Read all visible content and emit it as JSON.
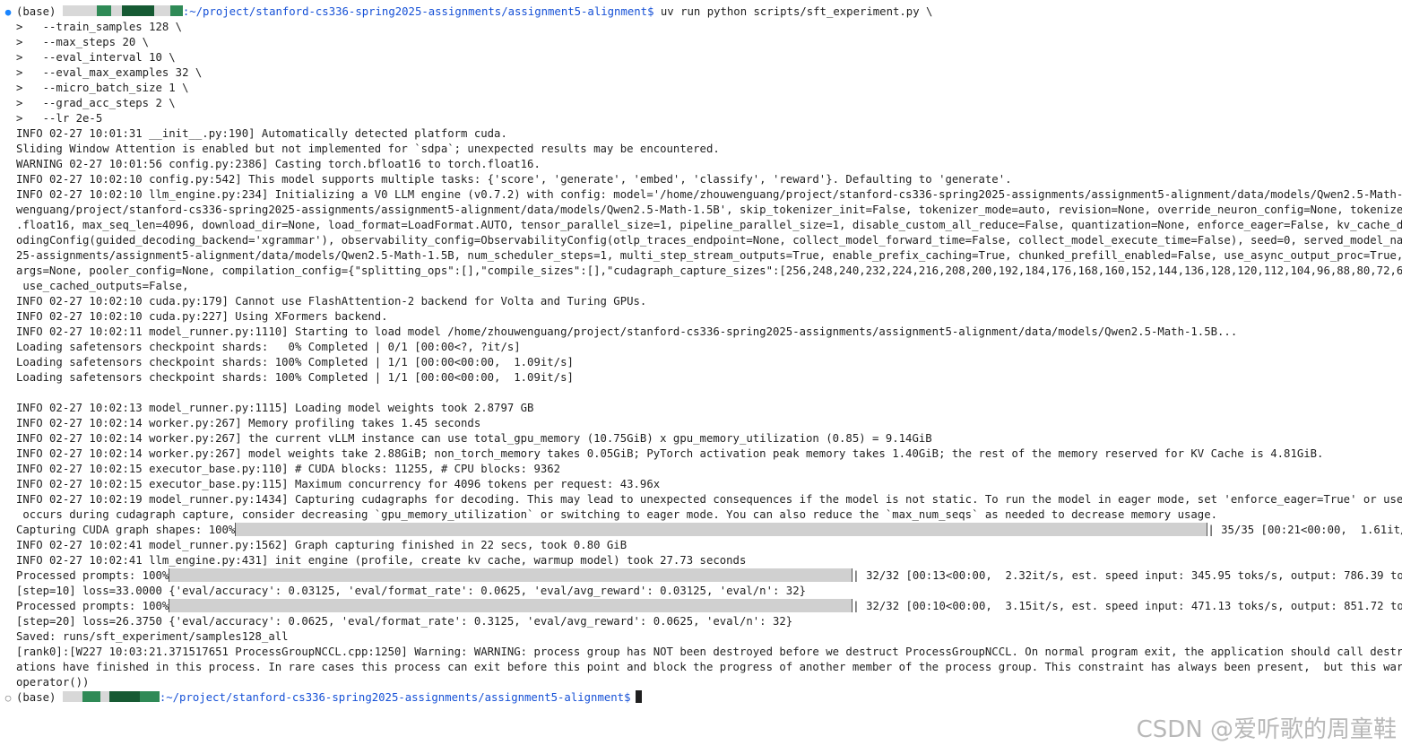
{
  "terminal": {
    "cmd": {
      "env": "(base)",
      "path": ":~/project/stanford-cs336-spring2025-assignments/assignment5-alignment$",
      "command": " uv run python scripts/sft_experiment.py \\"
    },
    "args": [
      ">   --train_samples 128 \\",
      ">   --max_steps 20 \\",
      ">   --eval_interval 10 \\",
      ">   --eval_max_examples 32 \\",
      ">   --micro_batch_size 1 \\",
      ">   --grad_acc_steps 2 \\",
      ">   --lr 2e-5"
    ],
    "log1": [
      "INFO 02-27 10:01:31 __init__.py:190] Automatically detected platform cuda.",
      "Sliding Window Attention is enabled but not implemented for `sdpa`; unexpected results may be encountered.",
      "WARNING 02-27 10:01:56 config.py:2386] Casting torch.bfloat16 to torch.float16.",
      "INFO 02-27 10:02:10 config.py:542] This model supports multiple tasks: {'score', 'generate', 'embed', 'classify', 'reward'}. Defaulting to 'generate'.",
      "INFO 02-27 10:02:10 llm_engine.py:234] Initializing a V0 LLM engine (v0.7.2) with config: model='/home/zhouwenguang/project/stanford-cs336-spring2025-assignments/assignment5-alignment/data/models/Qwen2.5-Math-1.5B', specu",
      "wenguang/project/stanford-cs336-spring2025-assignments/assignment5-alignment/data/models/Qwen2.5-Math-1.5B', skip_tokenizer_init=False, tokenizer_mode=auto, revision=None, override_neuron_config=None, tokenizer_revision=N",
      ".float16, max_seq_len=4096, download_dir=None, load_format=LoadFormat.AUTO, tensor_parallel_size=1, pipeline_parallel_size=1, disable_custom_all_reduce=False, quantization=None, enforce_eager=False, kv_cache_dtype=auto,",
      "odingConfig(guided_decoding_backend='xgrammar'), observability_config=ObservabilityConfig(otlp_traces_endpoint=None, collect_model_forward_time=False, collect_model_execute_time=False), seed=0, served_model_name=/home/zho",
      "25-assignments/assignment5-alignment/data/models/Qwen2.5-Math-1.5B, num_scheduler_steps=1, multi_step_stream_outputs=True, enable_prefix_caching=True, chunked_prefill_enabled=False, use_async_output_proc=True, disable_mm_",
      "args=None, pooler_config=None, compilation_config={\"splitting_ops\":[],\"compile_sizes\":[],\"cudagraph_capture_sizes\":[256,248,240,232,224,216,208,200,192,184,176,168,160,152,144,136,128,120,112,104,96,88,80,72,64,56,48,40,3",
      " use_cached_outputs=False,",
      "INFO 02-27 10:02:10 cuda.py:179] Cannot use FlashAttention-2 backend for Volta and Turing GPUs.",
      "INFO 02-27 10:02:10 cuda.py:227] Using XFormers backend.",
      "INFO 02-27 10:02:11 model_runner.py:1110] Starting to load model /home/zhouwenguang/project/stanford-cs336-spring2025-assignments/assignment5-alignment/data/models/Qwen2.5-Math-1.5B...",
      "Loading safetensors checkpoint shards:   0% Completed | 0/1 [00:00<?, ?it/s]",
      "Loading safetensors checkpoint shards: 100% Completed | 1/1 [00:00<00:00,  1.09it/s]",
      "Loading safetensors checkpoint shards: 100% Completed | 1/1 [00:00<00:00,  1.09it/s]",
      "",
      "INFO 02-27 10:02:13 model_runner.py:1115] Loading model weights took 2.8797 GB",
      "INFO 02-27 10:02:14 worker.py:267] Memory profiling takes 1.45 seconds",
      "INFO 02-27 10:02:14 worker.py:267] the current vLLM instance can use total_gpu_memory (10.75GiB) x gpu_memory_utilization (0.85) = 9.14GiB",
      "INFO 02-27 10:02:14 worker.py:267] model weights take 2.88GiB; non_torch_memory takes 0.05GiB; PyTorch activation peak memory takes 1.40GiB; the rest of the memory reserved for KV Cache is 4.81GiB.",
      "INFO 02-27 10:02:15 executor_base.py:110] # CUDA blocks: 11255, # CPU blocks: 9362",
      "INFO 02-27 10:02:15 executor_base.py:115] Maximum concurrency for 4096 tokens per request: 43.96x",
      "INFO 02-27 10:02:19 model_runner.py:1434] Capturing cudagraphs for decoding. This may lead to unexpected consequences if the model is not static. To run the model in eager mode, set 'enforce_eager=True' or use '--enforce-",
      " occurs during cudagraph capture, consider decreasing `gpu_memory_utilization` or switching to eager mode. You can also reduce the `max_num_seqs` as needed to decrease memory usage."
    ],
    "cuda_bar": {
      "prefix": "Capturing CUDA graph shapes: 100%",
      "suffix": "| 35/35 [00:21<00:00,  1.61it/s]",
      "progress": 1.0
    },
    "log2": [
      "INFO 02-27 10:02:41 model_runner.py:1562] Graph capturing finished in 22 secs, took 0.80 GiB",
      "INFO 02-27 10:02:41 llm_engine.py:431] init engine (profile, create kv cache, warmup model) took 27.73 seconds"
    ],
    "prompts_bar_1": {
      "prefix": "Processed prompts: 100%",
      "suffix": "| 32/32 [00:13<00:00,  2.32it/s, est. speed input: 345.95 toks/s, output: 786.39 toks/s]",
      "progress": 1.0
    },
    "step10": "[step=10] loss=33.0000 {'eval/accuracy': 0.03125, 'eval/format_rate': 0.0625, 'eval/avg_reward': 0.03125, 'eval/n': 32}",
    "prompts_bar_2": {
      "prefix": "Processed prompts: 100%",
      "suffix": "| 32/32 [00:10<00:00,  3.15it/s, est. speed input: 471.13 toks/s, output: 851.72 toks/s]",
      "progress": 1.0
    },
    "step20": "[step=20] loss=26.3750 {'eval/accuracy': 0.0625, 'eval/format_rate': 0.3125, 'eval/avg_reward': 0.0625, 'eval/n': 32}",
    "log3": [
      "Saved: runs/sft_experiment/samples128_all",
      "[rank0]:[W227 10:03:21.371517651 ProcessGroupNCCL.cpp:1250] Warning: WARNING: process group has NOT been destroyed before we destruct ProcessGroupNCCL. On normal program exit, the application should call destroy_process_g",
      "ations have finished in this process. In rare cases this process can exit before this point and block the progress of another member of the process group. This constraint has always been present,  but this warning has onl",
      "operator())"
    ],
    "prompt": {
      "env": "(base)",
      "path": ":~/project/stanford-cs336-spring2025-assignments/assignment5-alignment$"
    },
    "gutter": {
      "active": "●",
      "inactive": "○"
    },
    "colors": {
      "path": "#1550d6",
      "text": "#1f1f1f",
      "dot_active": "#1a85ff",
      "bar_fill": "#d0d0d0"
    }
  },
  "watermark": "CSDN @爱听歌的周童鞋"
}
